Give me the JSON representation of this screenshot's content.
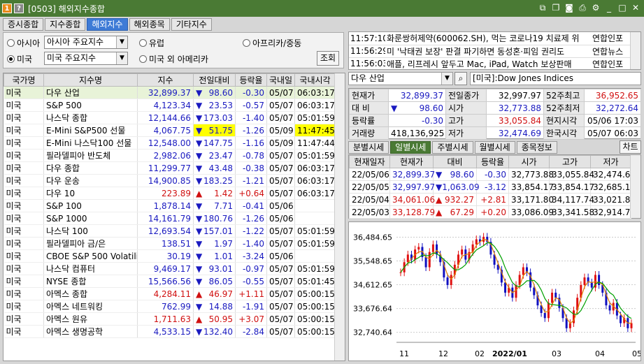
{
  "window": {
    "title": "[0503] 해외지수종합",
    "badge1": "1",
    "badge2": "?"
  },
  "tabs": [
    "증시종합",
    "지수종합",
    "해외지수",
    "해외종목",
    "기타지수"
  ],
  "filter": {
    "regions": [
      "아시아",
      "유럽",
      "아프리카/중동",
      "미국",
      "미국 외 아메리카"
    ],
    "asia_select": "아시아 주요지수",
    "us_select": "미국 주요지수",
    "query_button": "조회"
  },
  "table": {
    "headers": [
      "국가명",
      "지수명",
      "지수",
      "전일대비",
      "등락율",
      "국내일",
      "국내시각"
    ],
    "rows": [
      {
        "country": "미국",
        "name": "다우 산업",
        "value": "32,899.37",
        "dir": "▼",
        "chg": "98.60",
        "pct": "-0.30",
        "date": "05/07",
        "time": "06:03:17",
        "up": false
      },
      {
        "country": "미국",
        "name": "S&P 500",
        "value": "4,123.34",
        "dir": "▼",
        "chg": "23.53",
        "pct": "-0.57",
        "date": "05/07",
        "time": "06:03:17",
        "up": false
      },
      {
        "country": "미국",
        "name": "나스닥 종합",
        "value": "12,144.66",
        "dir": "▼",
        "chg": "173.03",
        "pct": "-1.40",
        "date": "05/07",
        "time": "05:01:59",
        "up": false
      },
      {
        "country": "미국",
        "name": "E-Mini S&P500 선물",
        "value": "4,067.75",
        "dir": "▼",
        "chg": "51.75",
        "pct": "-1.26",
        "date": "05/09",
        "time": "11:47:45",
        "up": false,
        "hl": true
      },
      {
        "country": "미국",
        "name": "E-Mini 나스닥100 선물",
        "value": "12,548.00",
        "dir": "▼",
        "chg": "147.75",
        "pct": "-1.16",
        "date": "05/09",
        "time": "11:47:44",
        "up": false
      },
      {
        "country": "미국",
        "name": "필라델피아 반도체",
        "value": "2,982.06",
        "dir": "▼",
        "chg": "23.47",
        "pct": "-0.78",
        "date": "05/07",
        "time": "05:01:59",
        "up": false
      },
      {
        "country": "미국",
        "name": "다우 종합",
        "value": "11,299.77",
        "dir": "▼",
        "chg": "43.48",
        "pct": "-0.38",
        "date": "05/07",
        "time": "06:03:17",
        "up": false
      },
      {
        "country": "미국",
        "name": "다우 운송",
        "value": "14,900.85",
        "dir": "▼",
        "chg": "183.25",
        "pct": "-1.21",
        "date": "05/07",
        "time": "06:03:17",
        "up": false
      },
      {
        "country": "미국",
        "name": "다우 10",
        "value": "223.89",
        "dir": "▲",
        "chg": "1.42",
        "pct": "+0.64",
        "date": "05/07",
        "time": "06:03:17",
        "up": true
      },
      {
        "country": "미국",
        "name": "S&P 100",
        "value": "1,878.14",
        "dir": "▼",
        "chg": "7.71",
        "pct": "-0.41",
        "date": "05/06",
        "time": "",
        "up": false
      },
      {
        "country": "미국",
        "name": "S&P 1000",
        "value": "14,161.79",
        "dir": "▼",
        "chg": "180.76",
        "pct": "-1.26",
        "date": "05/06",
        "time": "",
        "up": false
      },
      {
        "country": "미국",
        "name": "나스닥 100",
        "value": "12,693.54",
        "dir": "▼",
        "chg": "157.01",
        "pct": "-1.22",
        "date": "05/07",
        "time": "05:01:59",
        "up": false
      },
      {
        "country": "미국",
        "name": "필라델피아 금/은",
        "value": "138.51",
        "dir": "▼",
        "chg": "1.97",
        "pct": "-1.40",
        "date": "05/07",
        "time": "05:01:59",
        "up": false
      },
      {
        "country": "미국",
        "name": "CBOE S&P 500 Volatili",
        "value": "30.19",
        "dir": "▼",
        "chg": "1.01",
        "pct": "-3.24",
        "date": "05/06",
        "time": "",
        "up": false
      },
      {
        "country": "미국",
        "name": "나스닥 컴퓨터",
        "value": "9,469.17",
        "dir": "▼",
        "chg": "93.01",
        "pct": "-0.97",
        "date": "05/07",
        "time": "05:01:59",
        "up": false
      },
      {
        "country": "미국",
        "name": "NYSE 종합",
        "value": "15,566.56",
        "dir": "▼",
        "chg": "86.05",
        "pct": "-0.55",
        "date": "05/07",
        "time": "05:01:45",
        "up": false
      },
      {
        "country": "미국",
        "name": "아멕스 종합",
        "value": "4,284.11",
        "dir": "▲",
        "chg": "46.97",
        "pct": "+1.11",
        "date": "05/07",
        "time": "05:00:15",
        "up": true
      },
      {
        "country": "미국",
        "name": "아멕스 네트워킹",
        "value": "762.99",
        "dir": "▼",
        "chg": "14.88",
        "pct": "-1.91",
        "date": "05/07",
        "time": "05:00:15",
        "up": false
      },
      {
        "country": "미국",
        "name": "아멕스 원유",
        "value": "1,711.63",
        "dir": "▲",
        "chg": "50.95",
        "pct": "+3.07",
        "date": "05/07",
        "time": "05:00:15",
        "up": true
      },
      {
        "country": "미국",
        "name": "아멕스 생명공학",
        "value": "4,533.15",
        "dir": "▼",
        "chg": "132.40",
        "pct": "-2.84",
        "date": "05/07",
        "time": "05:00:15",
        "up": false
      }
    ]
  },
  "news": [
    {
      "time": "11:57:10",
      "headline": "화룬쌍허제약(600062.SH), 먹는 코로나19 치료제 위",
      "source": "연합인포"
    },
    {
      "time": "11:56:29",
      "headline": "미 '낙태권 보장' 판결 파기하면 동성혼·피임 권리도",
      "source": "연합뉴스"
    },
    {
      "time": "11:56:03",
      "headline": "애플, 리프레시 앞두고 Mac, iPad, Watch 보상판매",
      "source": "연합인포"
    }
  ],
  "symbol": {
    "name": "다우 산업",
    "desc": "[미국]:Dow Jones Indices"
  },
  "quote": {
    "cur_label": "현재가",
    "cur": "32,899.37",
    "prev_label": "전일종가",
    "prev": "32,997.97",
    "w52h_label": "52주최고",
    "w52h": "36,952.65",
    "cmp_label": "대 비",
    "cmp_dir": "▼",
    "cmp": "98.60",
    "open_label": "시가",
    "open": "32,773.88",
    "w52l_label": "52주최저",
    "w52l": "32,272.64",
    "rate_label": "등락률",
    "rate": "-0.30",
    "high_label": "고가",
    "high": "33,055.84",
    "local_label": "현지시각",
    "local": "05/06 17:03",
    "vol_label": "거래량",
    "vol": "418,136,925",
    "low_label": "저가",
    "low": "32,474.69",
    "kr_label": "한국시각",
    "kr": "05/07 06:03"
  },
  "subtabs": [
    "분별시세",
    "일별시세",
    "주별시세",
    "월별시세",
    "종목정보"
  ],
  "chart_button": "차트",
  "daily": {
    "headers": [
      "현재일자",
      "현재가",
      "대비",
      "등락율",
      "시가",
      "고가",
      "저가"
    ],
    "rows": [
      {
        "date": "22/05/06",
        "cur": "32,899.37",
        "dir": "▼",
        "chg": "98.60",
        "pct": "-0.30",
        "open": "32,773.88",
        "high": "33,055.84",
        "low": "32,474.69",
        "up": false
      },
      {
        "date": "22/05/05",
        "cur": "32,997.97",
        "dir": "▼",
        "chg": "1,063.09",
        "pct": "-3.12",
        "open": "33,854.17",
        "high": "33,854.17",
        "low": "32,685.10",
        "up": false
      },
      {
        "date": "22/05/04",
        "cur": "34,061.06",
        "dir": "▲",
        "chg": "932.27",
        "pct": "+2.81",
        "open": "33,171.80",
        "high": "34,117.74",
        "low": "33,021.84",
        "up": true
      },
      {
        "date": "22/05/03",
        "cur": "33,128.79",
        "dir": "▲",
        "chg": "67.29",
        "pct": "+0.20",
        "open": "33,086.09",
        "high": "33,341.58",
        "low": "32,914.75",
        "up": true
      }
    ]
  },
  "chart_data": {
    "type": "line",
    "y_ticks": [
      "36,484.65",
      "35,548.65",
      "34,612.65",
      "33,676.64",
      "32,740.64"
    ],
    "ylim": [
      32400,
      36800
    ],
    "x_ticks": [
      "11",
      "12",
      "2022/01",
      "02",
      "03",
      "04",
      "05"
    ],
    "colors": {
      "candle": "#e01010",
      "down": "#1010c0",
      "ma1": "#00a000",
      "ma2": "#e08000"
    },
    "series": [
      {
        "values": [
          35100,
          35500,
          35800,
          35600,
          36000,
          36100,
          35700,
          35300,
          35900,
          36200,
          35800,
          35500,
          34900,
          34600,
          35000,
          35400,
          35800,
          36000,
          35600,
          35900,
          36200,
          36400,
          36300,
          36500,
          36300,
          35800,
          35400,
          35200,
          34700,
          34300,
          34500,
          34100,
          34600,
          35000,
          35300,
          35100,
          34500,
          34200,
          33800,
          33500,
          33300,
          33900,
          34300,
          34100,
          33700,
          33300,
          32900,
          33100,
          33600,
          34100,
          34600,
          34900,
          34700,
          34500,
          35000,
          34600,
          34300,
          33800,
          33600,
          33900,
          33400,
          33100,
          33300,
          32900,
          33100
        ]
      }
    ]
  }
}
